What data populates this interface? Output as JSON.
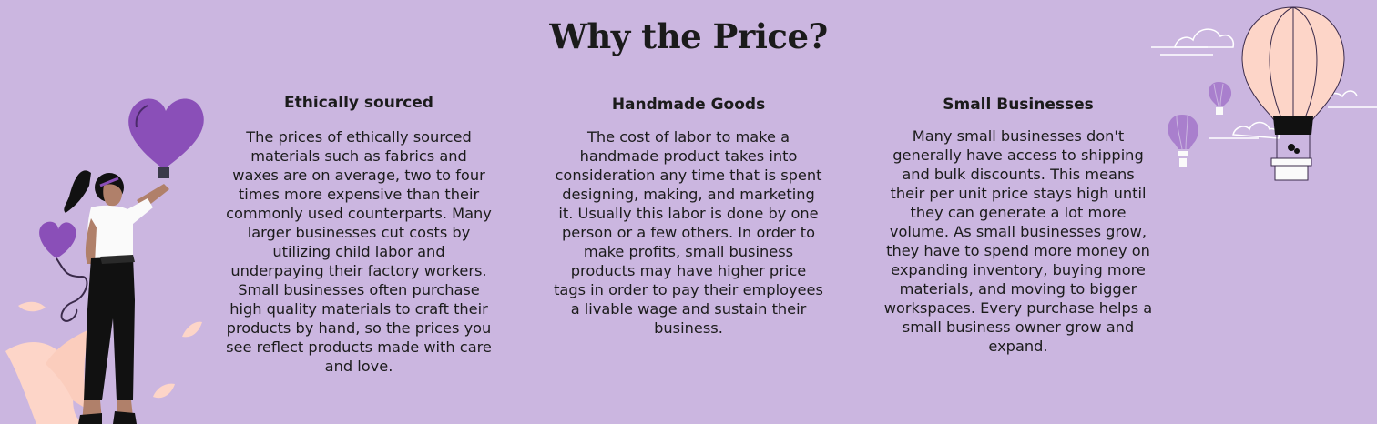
{
  "title": "Why the Price?",
  "columns": [
    {
      "heading": "Ethically sourced",
      "body": "The prices of ethically sourced materials such as fabrics and waxes are on average, two to four times more expensive than their commonly used counterparts. Many larger businesses cut costs by utilizing child labor and underpaying their factory workers. Small businesses often purchase high quality materials to craft their products by hand, so the prices you see reflect products made with care and love."
    },
    {
      "heading": "Handmade Goods",
      "body": "The cost of labor to make a handmade product takes into consideration any time that is spent designing, making, and marketing it. Usually this labor is done by one person or a few others. In order to make profits, small business products may have higher price tags in order to pay their employees a livable wage and sustain their business."
    },
    {
      "heading": "Small Businesses",
      "body": "Many small businesses don't generally have access to shipping and bulk discounts. This means their per unit price stays high until they can generate a lot more volume. As small businesses grow, they have to spend more money on expanding inventory,  buying more materials, and moving to bigger workspaces. Every purchase helps a small business owner grow and expand."
    }
  ],
  "colors": {
    "background": "#cbb6e0",
    "purple": "#8a4fb8",
    "peach": "#fdd5c8"
  }
}
